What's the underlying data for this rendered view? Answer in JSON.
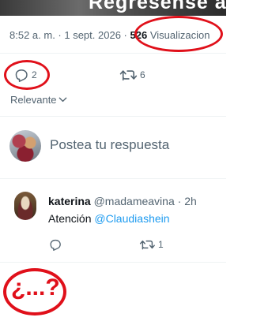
{
  "banner": {
    "text": "Regresense a su"
  },
  "tweet_meta": {
    "time_date": "8:52 a. m. · 1 sept. 2026 ·",
    "views_count": "526",
    "views_label": "Visualizacion"
  },
  "tweet_actions": {
    "replies_count": "2",
    "retweets_count": "6"
  },
  "sort": {
    "label": "Relevante"
  },
  "composer": {
    "placeholder": "Postea tu respuesta"
  },
  "reply": {
    "name": "katerina",
    "handle": "@madameavina",
    "time": "· 2h",
    "text_prefix": "Atención ",
    "mention": "@Claudiashein",
    "retweets_count": "1"
  },
  "annotation": {
    "text": "¿...?"
  },
  "colors": {
    "annotation_red": "#e0101a",
    "link_blue": "#1d9bf0",
    "muted_gray": "#536471"
  }
}
